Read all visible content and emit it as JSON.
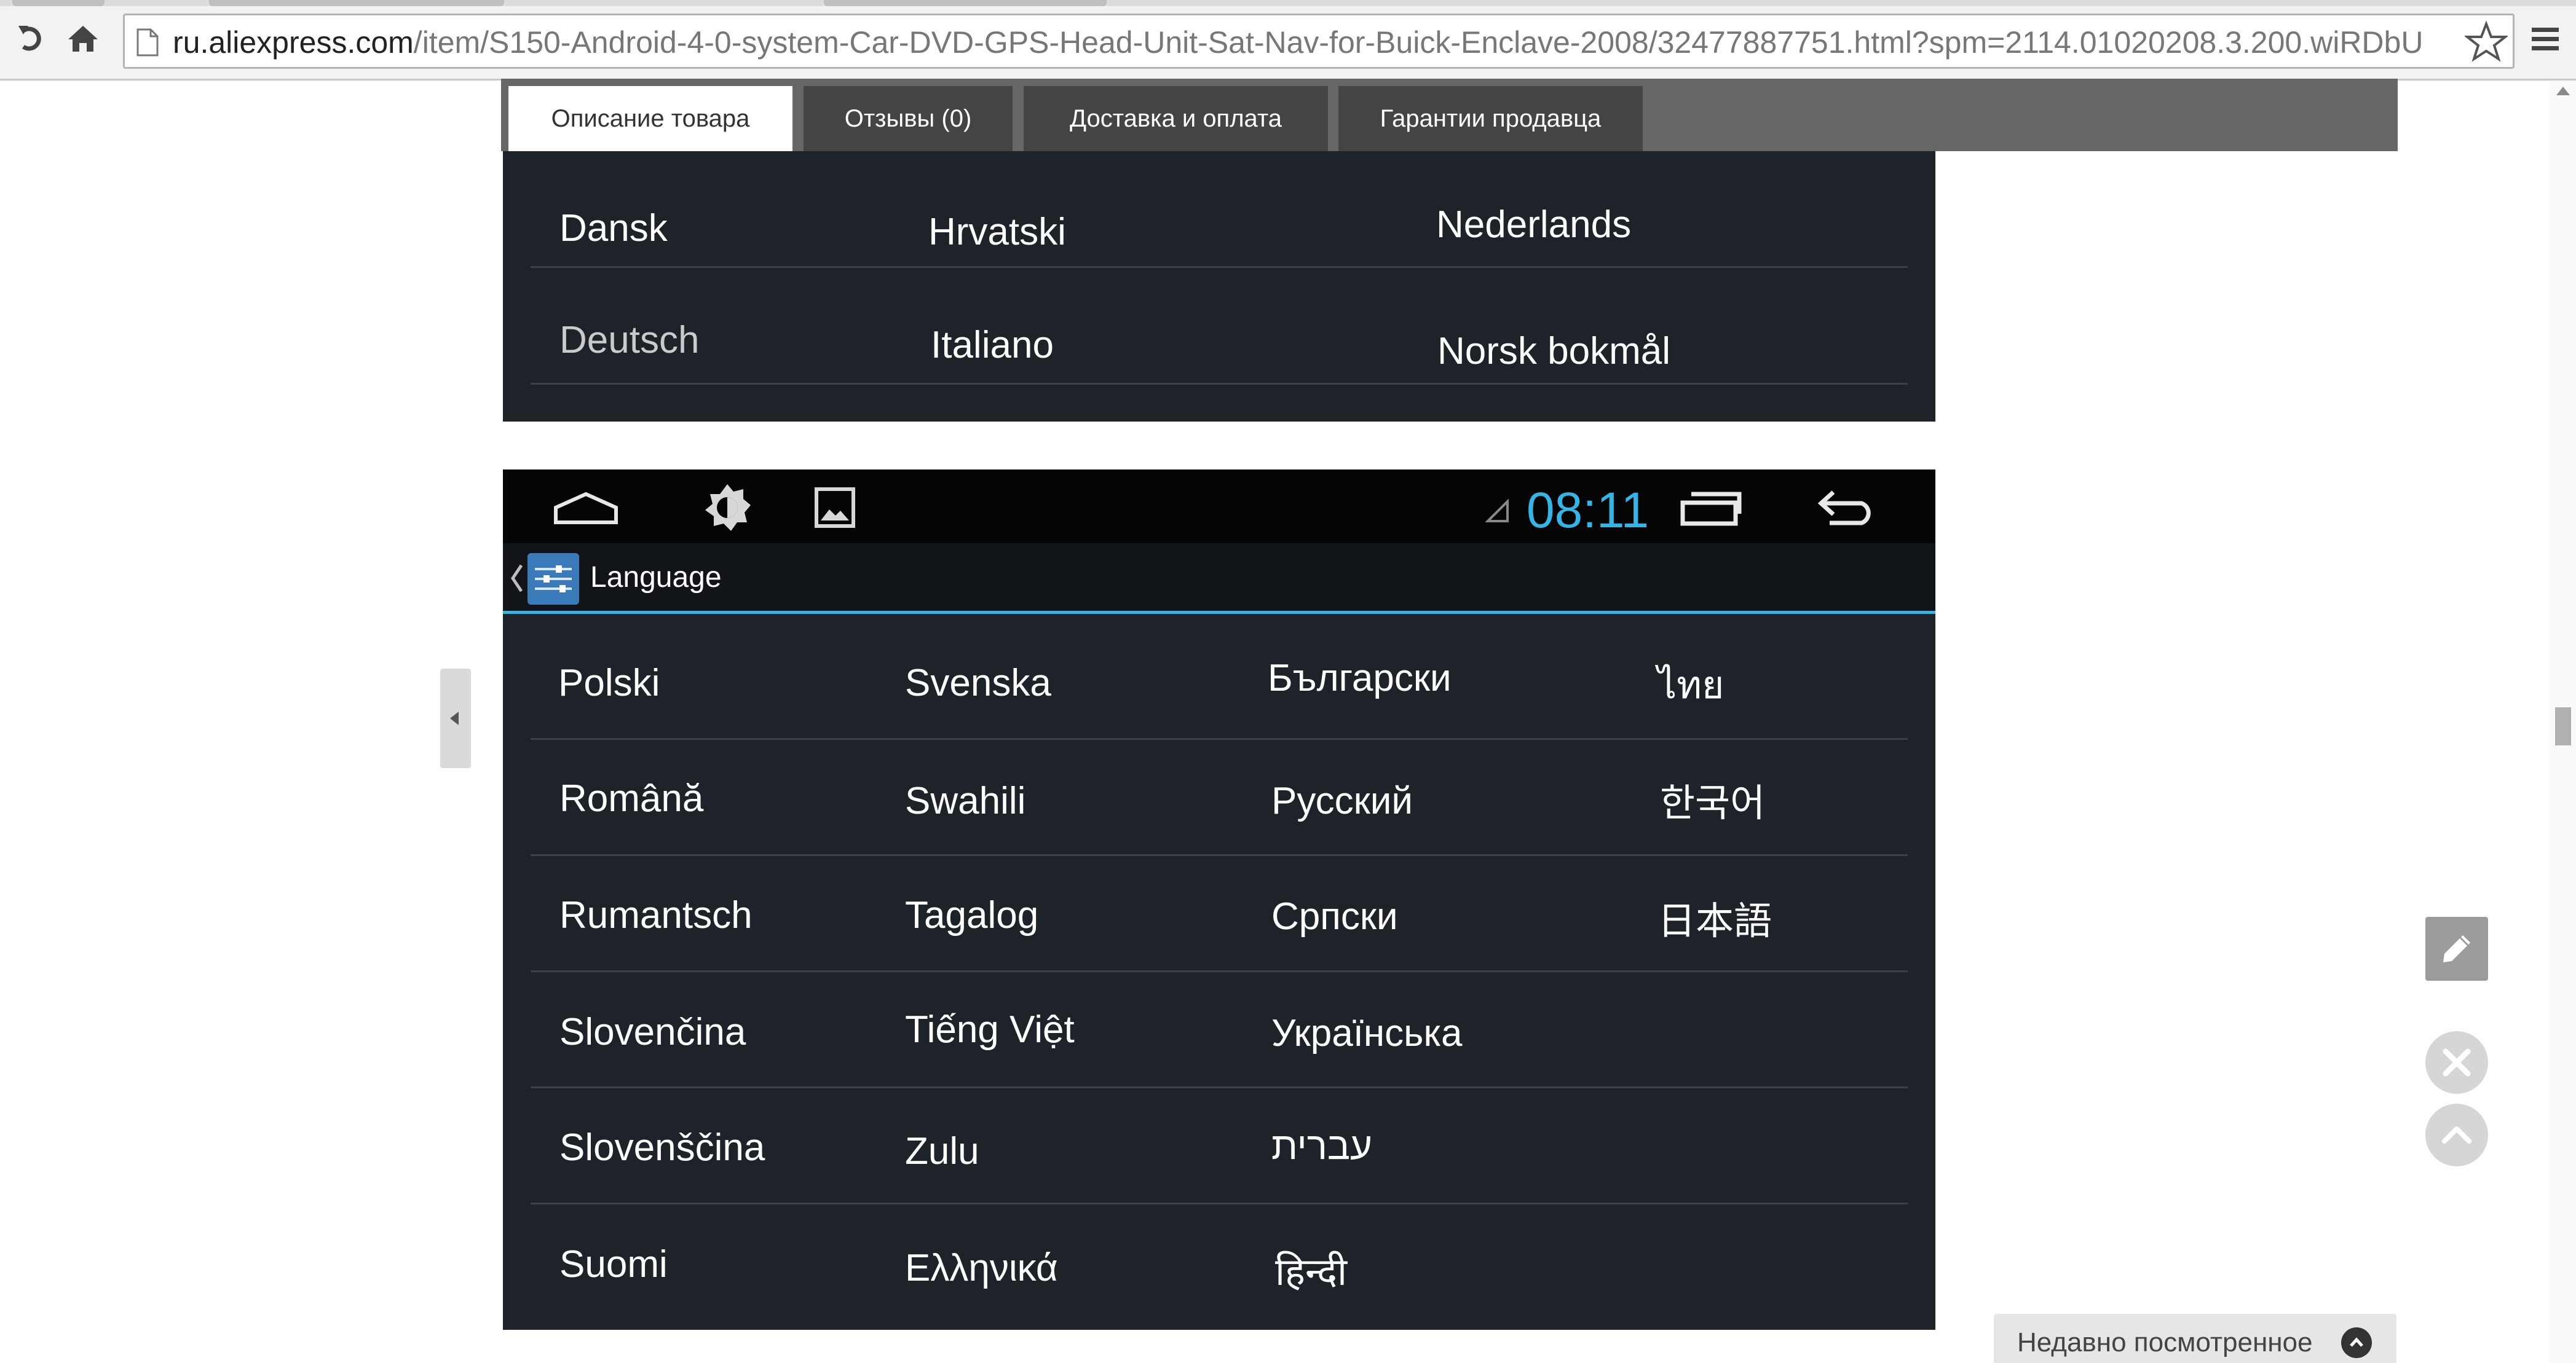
{
  "browser": {
    "url_host": "ru.aliexpress.com",
    "url_path": "/item/S150-Android-4-0-system-Car-DVD-GPS-Head-Unit-Sat-Nav-for-Buick-Enclave-2008/32477887751.html?spm=2114.01020208.3.200.wiRDbU"
  },
  "product_tabs": [
    {
      "label": "Описание товара",
      "active": true
    },
    {
      "label": "Отзывы (0)"
    },
    {
      "label": "Доставка и оплата"
    },
    {
      "label": "Гарантии продавца"
    }
  ],
  "top_list": [
    [
      "Dansk",
      "Hrvatski",
      "Nederlands"
    ],
    [
      "Deutsch",
      "Italiano",
      "Norsk bokmål"
    ]
  ],
  "android": {
    "clock": "08:11",
    "screen_title": "Language",
    "accent_color": "#33b5e5",
    "languages": [
      [
        "Polski",
        "Svenska",
        "Български",
        "ไทย"
      ],
      [
        "Română",
        "Swahili",
        "Русский",
        "한국어"
      ],
      [
        "Rumantsch",
        "Tagalog",
        "Српски",
        "日本語"
      ],
      [
        "Slovenčina",
        "Tiếng Việt",
        "Українська",
        ""
      ],
      [
        "Slovenščina",
        "Zulu",
        "עברית",
        ""
      ],
      [
        "Suomi",
        "Ελληνικά",
        "हिन्दी",
        ""
      ]
    ]
  },
  "sidebar": {
    "recently_viewed": "Недавно посмотренное"
  },
  "icons": [
    "reload-icon",
    "home-icon",
    "page-icon",
    "bookmark-star-icon",
    "menu-icon",
    "android-home-icon",
    "brightness-icon",
    "gallery-icon",
    "signal-icon",
    "recent-apps-icon",
    "android-back-icon",
    "settings-app-icon",
    "pencil-icon",
    "close-icon",
    "scroll-top-icon"
  ]
}
